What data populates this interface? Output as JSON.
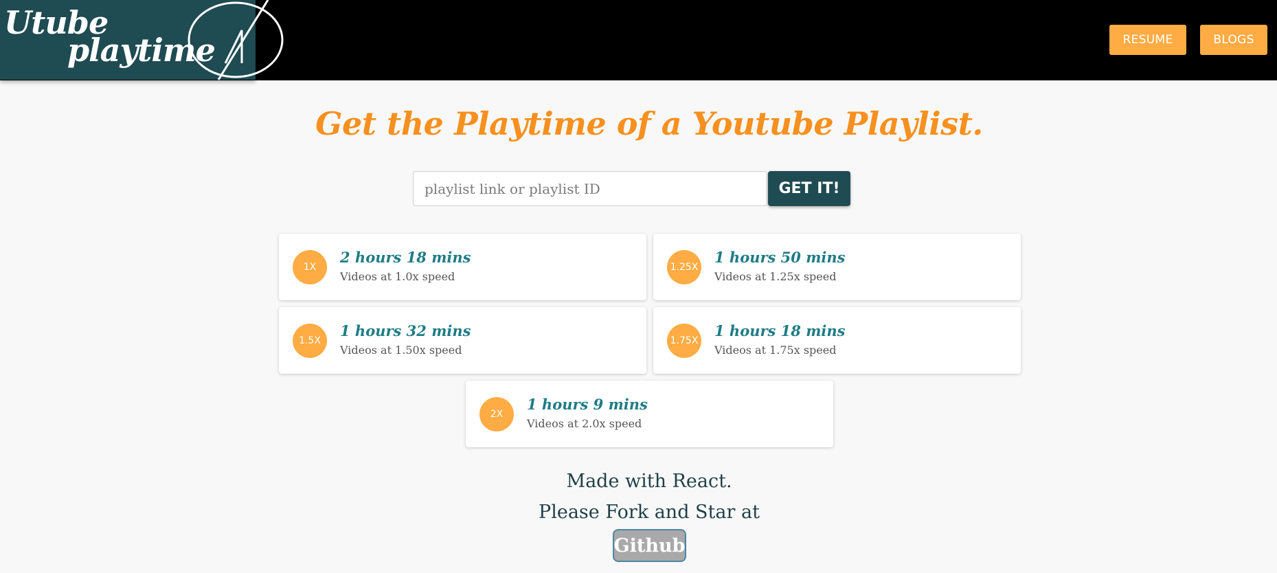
{
  "header": {
    "logo": {
      "line1": "Utube",
      "line2": "playtime"
    },
    "nav": {
      "resume_label": "RESUME",
      "blogs_label": "BLOGS"
    }
  },
  "main": {
    "headline": "Get the Playtime of a Youtube Playlist.",
    "search": {
      "placeholder": "playlist link or playlist ID",
      "value": ""
    },
    "get_button_label": "GET IT!",
    "results": [
      {
        "badge": "1X",
        "duration": "2 hours 18 mins",
        "description": "Videos at 1.0x speed"
      },
      {
        "badge": "1.25X",
        "duration": "1 hours 50 mins",
        "description": "Videos at 1.25x speed"
      },
      {
        "badge": "1.5X",
        "duration": "1 hours 32 mins",
        "description": "Videos at 1.50x speed"
      },
      {
        "badge": "1.75X",
        "duration": "1 hours 18 mins",
        "description": "Videos at 1.75x speed"
      },
      {
        "badge": "2X",
        "duration": "1 hours 9 mins",
        "description": "Videos at 2.0x speed"
      }
    ]
  },
  "footer": {
    "line1": "Made with React.",
    "line2": "Please Fork and Star at",
    "github_label": "Github"
  },
  "colors": {
    "header_bg": "#000000",
    "logo_bg": "#1f4b52",
    "accent": "#ffac44",
    "headline": "#f7901e",
    "duration_text": "#1e7c85"
  }
}
